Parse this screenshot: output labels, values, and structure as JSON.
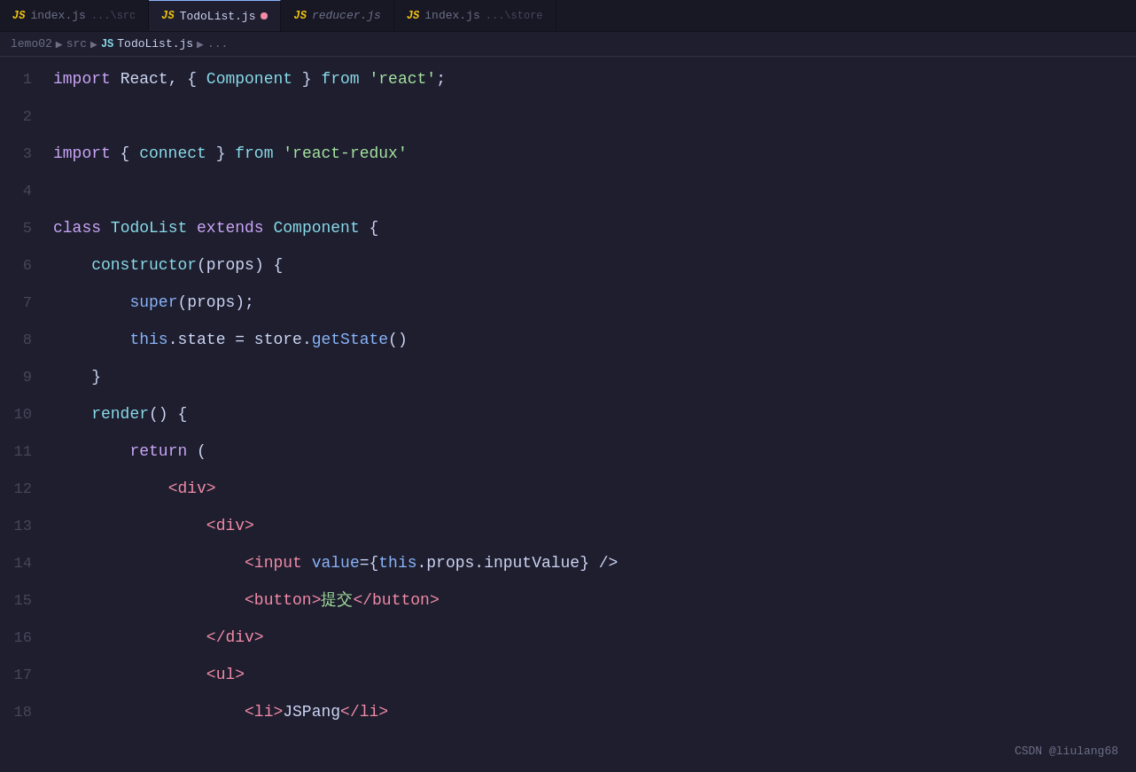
{
  "tabs": [
    {
      "id": "tab-indexjs-src",
      "jsIcon": "JS",
      "label": "index.js",
      "sublabel": "...\\src",
      "active": false,
      "modified": false
    },
    {
      "id": "tab-todolist",
      "jsIcon": "JS",
      "label": "TodoList.js",
      "sublabel": "",
      "active": true,
      "modified": true
    },
    {
      "id": "tab-reducer",
      "jsIcon": "JS",
      "label": "reducer.js",
      "sublabel": "",
      "active": false,
      "modified": false,
      "italic": true
    },
    {
      "id": "tab-indexjs-store",
      "jsIcon": "JS",
      "label": "index.js",
      "sublabel": "...\\store",
      "active": false,
      "modified": false
    }
  ],
  "breadcrumb": {
    "root": "lemo02",
    "path1": "src",
    "jsIcon": "JS",
    "file": "TodoList.js",
    "extra": "..."
  },
  "lines": [
    {
      "num": "1",
      "tokens": [
        {
          "t": "kw-import",
          "v": "import"
        },
        {
          "t": "punct",
          "v": " "
        },
        {
          "t": "plain",
          "v": "React, { "
        },
        {
          "t": "component",
          "v": "Component"
        },
        {
          "t": "plain",
          "v": " } "
        },
        {
          "t": "kw-from",
          "v": "from"
        },
        {
          "t": "plain",
          "v": " "
        },
        {
          "t": "string",
          "v": "'react'"
        },
        {
          "t": "punct",
          "v": ";"
        }
      ]
    },
    {
      "num": "2",
      "tokens": []
    },
    {
      "num": "3",
      "tokens": [
        {
          "t": "kw-import",
          "v": "import"
        },
        {
          "t": "plain",
          "v": " { "
        },
        {
          "t": "connect-fn",
          "v": "connect"
        },
        {
          "t": "plain",
          "v": " } "
        },
        {
          "t": "kw-from",
          "v": "from"
        },
        {
          "t": "plain",
          "v": " "
        },
        {
          "t": "string",
          "v": "'react-redux'"
        }
      ]
    },
    {
      "num": "4",
      "tokens": []
    },
    {
      "num": "5",
      "tokens": [
        {
          "t": "kw-class",
          "v": "class"
        },
        {
          "t": "plain",
          "v": " "
        },
        {
          "t": "class-name",
          "v": "TodoList"
        },
        {
          "t": "plain",
          "v": " "
        },
        {
          "t": "kw-extends",
          "v": "extends"
        },
        {
          "t": "plain",
          "v": " "
        },
        {
          "t": "component",
          "v": "Component"
        },
        {
          "t": "plain",
          "v": " {"
        }
      ]
    },
    {
      "num": "6",
      "tokens": [
        {
          "t": "indent",
          "v": "    "
        },
        {
          "t": "kw-constructor",
          "v": "constructor"
        },
        {
          "t": "plain",
          "v": "("
        },
        {
          "t": "plain",
          "v": "props"
        },
        {
          "t": "plain",
          "v": ") {"
        }
      ]
    },
    {
      "num": "7",
      "tokens": [
        {
          "t": "indent",
          "v": "        "
        },
        {
          "t": "kw-super",
          "v": "super"
        },
        {
          "t": "plain",
          "v": "(props);"
        }
      ]
    },
    {
      "num": "8",
      "tokens": [
        {
          "t": "indent",
          "v": "        "
        },
        {
          "t": "kw-this",
          "v": "this"
        },
        {
          "t": "plain",
          "v": ".state = "
        },
        {
          "t": "plain",
          "v": "store"
        },
        {
          "t": "plain",
          "v": "."
        },
        {
          "t": "method",
          "v": "getState"
        },
        {
          "t": "plain",
          "v": "()"
        }
      ]
    },
    {
      "num": "9",
      "tokens": [
        {
          "t": "indent",
          "v": "    "
        },
        {
          "t": "plain",
          "v": "}"
        }
      ]
    },
    {
      "num": "10",
      "tokens": [
        {
          "t": "indent",
          "v": "    "
        },
        {
          "t": "kw-render",
          "v": "render"
        },
        {
          "t": "plain",
          "v": "() {"
        }
      ]
    },
    {
      "num": "11",
      "tokens": [
        {
          "t": "indent",
          "v": "        "
        },
        {
          "t": "kw-return",
          "v": "return"
        },
        {
          "t": "plain",
          "v": " ("
        }
      ]
    },
    {
      "num": "12",
      "tokens": [
        {
          "t": "indent",
          "v": "            "
        },
        {
          "t": "jsx-tag",
          "v": "<div>"
        }
      ]
    },
    {
      "num": "13",
      "tokens": [
        {
          "t": "indent",
          "v": "                "
        },
        {
          "t": "jsx-tag",
          "v": "<div>"
        }
      ]
    },
    {
      "num": "14",
      "tokens": [
        {
          "t": "indent",
          "v": "                    "
        },
        {
          "t": "jsx-tag",
          "v": "<input"
        },
        {
          "t": "plain",
          "v": " "
        },
        {
          "t": "jsx-attr",
          "v": "value"
        },
        {
          "t": "plain",
          "v": "={"
        },
        {
          "t": "kw-this",
          "v": "this"
        },
        {
          "t": "plain",
          "v": ".props.inputValue"
        },
        {
          "t": "plain",
          "v": "} />"
        }
      ]
    },
    {
      "num": "15",
      "tokens": [
        {
          "t": "indent",
          "v": "                    "
        },
        {
          "t": "jsx-tag",
          "v": "<button>"
        },
        {
          "t": "chinese",
          "v": "提交"
        },
        {
          "t": "jsx-tag",
          "v": "</button>"
        }
      ]
    },
    {
      "num": "16",
      "tokens": [
        {
          "t": "indent",
          "v": "                "
        },
        {
          "t": "jsx-tag",
          "v": "</div>"
        }
      ]
    },
    {
      "num": "17",
      "tokens": [
        {
          "t": "indent",
          "v": "                "
        },
        {
          "t": "jsx-tag",
          "v": "<ul>"
        }
      ]
    },
    {
      "num": "18",
      "tokens": [
        {
          "t": "indent",
          "v": "                    "
        },
        {
          "t": "jsx-tag",
          "v": "<li>"
        },
        {
          "t": "plain",
          "v": "JSPang"
        },
        {
          "t": "jsx-tag",
          "v": "</li>"
        }
      ]
    }
  ],
  "watermark": "CSDN @liulang68"
}
